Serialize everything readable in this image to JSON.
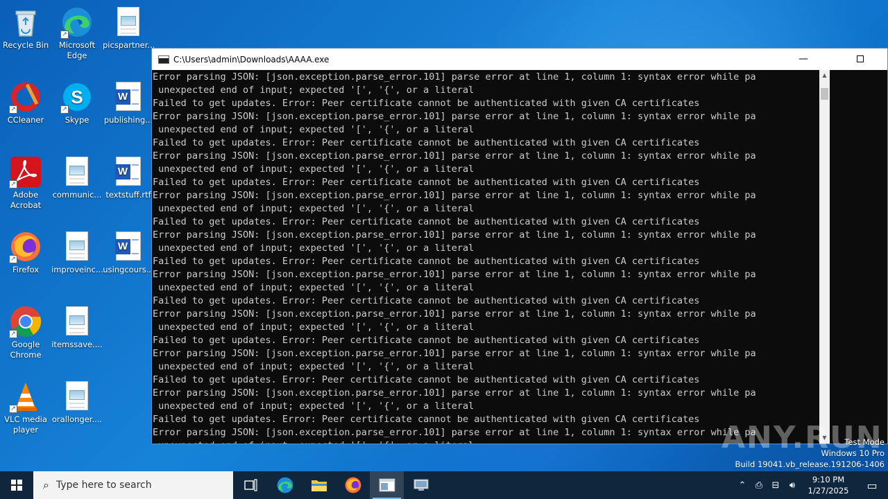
{
  "desktop": {
    "icons": [
      {
        "label": "Recycle Bin"
      },
      {
        "label": "Microsoft Edge"
      },
      {
        "label": "picspartner..."
      },
      {
        "label": "CCleaner"
      },
      {
        "label": "Skype"
      },
      {
        "label": "publishing..."
      },
      {
        "label": "Adobe Acrobat"
      },
      {
        "label": "communic..."
      },
      {
        "label": "textstuff.rtf"
      },
      {
        "label": "Firefox"
      },
      {
        "label": "improveinc..."
      },
      {
        "label": "usingcours..."
      },
      {
        "label": "Google Chrome"
      },
      {
        "label": "itemssave...."
      },
      {
        "label": "VLC media player"
      },
      {
        "label": "orallonger...."
      }
    ]
  },
  "console": {
    "title": "C:\\Users\\admin\\Downloads\\AAAA.exe",
    "minimize_glyph": "—",
    "lines": [
      "Error parsing JSON: [json.exception.parse_error.101] parse error at line 1, column 1: syntax error while pa",
      " unexpected end of input; expected '[', '{', or a literal",
      "Failed to get updates. Error: Peer certificate cannot be authenticated with given CA certificates",
      "Error parsing JSON: [json.exception.parse_error.101] parse error at line 1, column 1: syntax error while pa",
      " unexpected end of input; expected '[', '{', or a literal",
      "Failed to get updates. Error: Peer certificate cannot be authenticated with given CA certificates",
      "Error parsing JSON: [json.exception.parse_error.101] parse error at line 1, column 1: syntax error while pa",
      " unexpected end of input; expected '[', '{', or a literal",
      "Failed to get updates. Error: Peer certificate cannot be authenticated with given CA certificates",
      "Error parsing JSON: [json.exception.parse_error.101] parse error at line 1, column 1: syntax error while pa",
      " unexpected end of input; expected '[', '{', or a literal",
      "Failed to get updates. Error: Peer certificate cannot be authenticated with given CA certificates",
      "Error parsing JSON: [json.exception.parse_error.101] parse error at line 1, column 1: syntax error while pa",
      " unexpected end of input; expected '[', '{', or a literal",
      "Failed to get updates. Error: Peer certificate cannot be authenticated with given CA certificates",
      "Error parsing JSON: [json.exception.parse_error.101] parse error at line 1, column 1: syntax error while pa",
      " unexpected end of input; expected '[', '{', or a literal",
      "Failed to get updates. Error: Peer certificate cannot be authenticated with given CA certificates",
      "Error parsing JSON: [json.exception.parse_error.101] parse error at line 1, column 1: syntax error while pa",
      " unexpected end of input; expected '[', '{', or a literal",
      "Failed to get updates. Error: Peer certificate cannot be authenticated with given CA certificates",
      "Error parsing JSON: [json.exception.parse_error.101] parse error at line 1, column 1: syntax error while pa",
      " unexpected end of input; expected '[', '{', or a literal",
      "Failed to get updates. Error: Peer certificate cannot be authenticated with given CA certificates",
      "Error parsing JSON: [json.exception.parse_error.101] parse error at line 1, column 1: syntax error while pa",
      " unexpected end of input; expected '[', '{', or a literal",
      "Failed to get updates. Error: Peer certificate cannot be authenticated with given CA certificates",
      "Error parsing JSON: [json.exception.parse_error.101] parse error at line 1, column 1: syntax error while pa",
      " unexpected end of input; expected '[', '{', or a literal"
    ]
  },
  "watermark": {
    "text": "ANY.RUN",
    "test_mode": "Test Mode",
    "edition": "Windows 10 Pro",
    "build": "Build 19041.vb_release.191206-1406"
  },
  "taskbar": {
    "search_placeholder": "Type here to search",
    "time": "9:10 PM",
    "date": "1/27/2025"
  },
  "colors": {
    "desktop_blue": "#0a6fcf",
    "console_bg": "#0c0c0c",
    "console_text": "#cccccc",
    "taskbar_bg": "#10263d"
  }
}
